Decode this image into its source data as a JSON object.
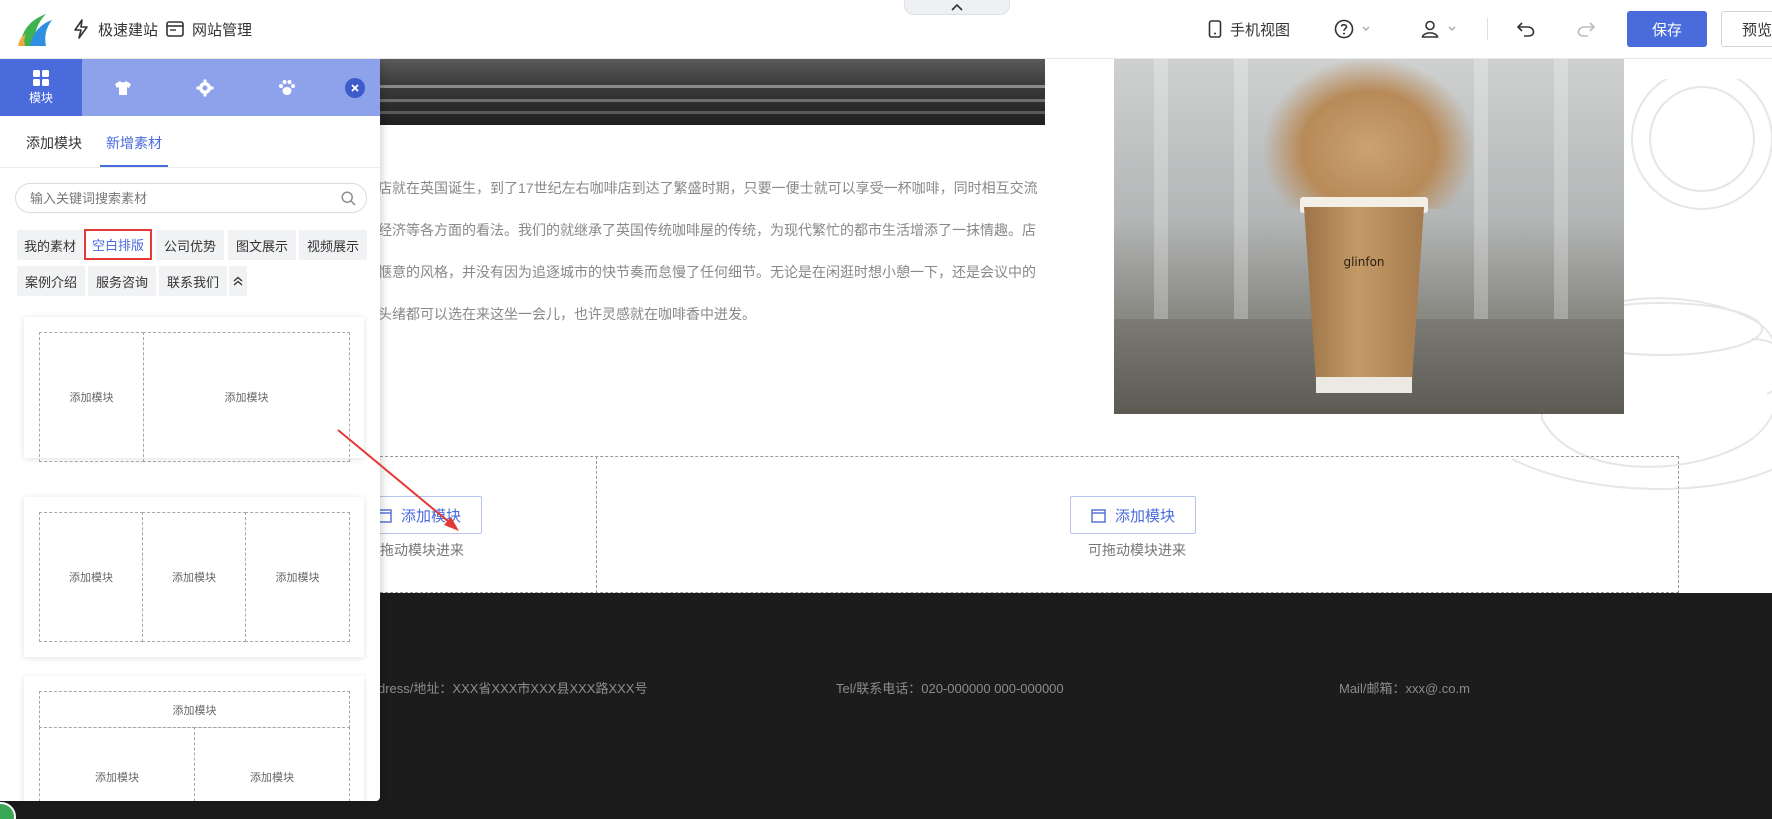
{
  "topbar": {
    "quick_build": "极速建站",
    "site_manage": "网站管理",
    "mobile_view": "手机视图",
    "save": "保存",
    "preview": "预览"
  },
  "panel": {
    "tabs": [
      {
        "label": "模块",
        "icon": "grid-icon",
        "active": true
      },
      {
        "label": "",
        "icon": "shirt-icon",
        "active": false
      },
      {
        "label": "",
        "icon": "gear-icon",
        "active": false
      },
      {
        "label": "",
        "icon": "paw-icon",
        "active": false
      }
    ],
    "sub_tabs": {
      "add_module": "添加模块",
      "new_material": "新增素材"
    },
    "search_placeholder": "输入关键词搜索素材",
    "categories": [
      "我的素材",
      "空白排版",
      "公司优势",
      "图文展示",
      "视频展示",
      "案例介绍",
      "服务咨询",
      "联系我们"
    ],
    "active_category": "空白排版",
    "cell_label": "添加模块"
  },
  "content": {
    "about_lines": [
      "店就在英国诞生，到了17世纪左右咖啡店到达了繁盛时期，只要一便士就可以享受一杯咖啡，同时相互交流",
      "经济等各方面的看法。我们的就继承了英国传统咖啡屋的传统，为现代繁忙的都市生活增添了一抹情趣。店",
      "惬意的风格，并没有因为追逐城市的快节奏而怠慢了任何细节。无论是在闲逛时想小憩一下，还是会议中的",
      "头绪都可以选在来这坐一会儿，也许灵感就在咖啡香中迸发。"
    ],
    "cup_brand": "glinfon",
    "add_module_btn": "添加模块",
    "drag_hint_left": "拖动模块进来",
    "drag_hint_right": "可拖动模块进来"
  },
  "footer": {
    "address": "dress/地址：XXX省XXX市XXX县XXX路XXX号",
    "tel": "Tel/联系电话：020-000000 000-000000",
    "mail": "Mail/邮箱：xxx@.co.m"
  },
  "colors": {
    "accent": "#4a6bdc",
    "panel_header": "#8ea2ec",
    "highlight_border": "#e53935",
    "footer_bg": "#1c1c1c"
  }
}
